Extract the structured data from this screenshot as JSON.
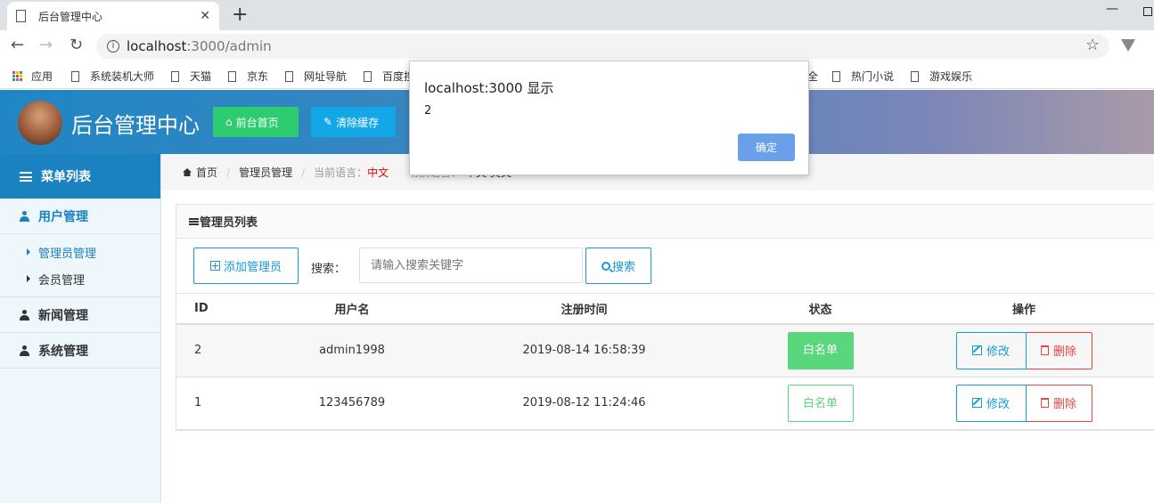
{
  "browser": {
    "tab_title": "后台管理中心",
    "url_host": "localhost",
    "url_rest": ":3000/admin",
    "bookmarks": [
      "应用",
      "系统装机大师",
      "天猫",
      "京东",
      "网址导航",
      "百度搜",
      "全",
      "热门小说",
      "游戏娱乐"
    ]
  },
  "header": {
    "title": "后台管理中心",
    "home_button": "前台首页",
    "clear_cache_button": "清除缓存"
  },
  "sidebar": {
    "title": "菜单列表",
    "groups": [
      {
        "label": "用户管理",
        "items": [
          "管理员管理",
          "会员管理"
        ]
      },
      {
        "label": "新闻管理"
      },
      {
        "label": "系统管理"
      }
    ]
  },
  "breadcrumb": {
    "home": "首页",
    "section": "管理员管理",
    "lang_label": "当前语言：",
    "lang_value": "中文",
    "switch_label": "切换语言：",
    "switch_value": "中文 英文"
  },
  "panel": {
    "title": "管理员列表",
    "add_button": "添加管理员",
    "search_label": "搜索：",
    "search_placeholder": "请输入搜索关键字",
    "search_button": "搜索",
    "columns": [
      "ID",
      "用户名",
      "注册时间",
      "状态",
      "操作"
    ],
    "rows": [
      {
        "id": "2",
        "username": "admin1998",
        "time": "2019-08-14 16:58:39",
        "status": "白名单",
        "edit": "修改",
        "delete": "删除"
      },
      {
        "id": "1",
        "username": "123456789",
        "time": "2019-08-12 11:24:46",
        "status": "白名单",
        "edit": "修改",
        "delete": "删除"
      }
    ]
  },
  "dialog": {
    "title": "localhost:3000 显示",
    "message": "2",
    "ok_button": "确定"
  },
  "colors": {
    "primary": "#1a82c1",
    "success": "#2ecc71",
    "info": "#14a7e8",
    "danger": "#e44",
    "dialog_button": "#6aa0ea"
  }
}
